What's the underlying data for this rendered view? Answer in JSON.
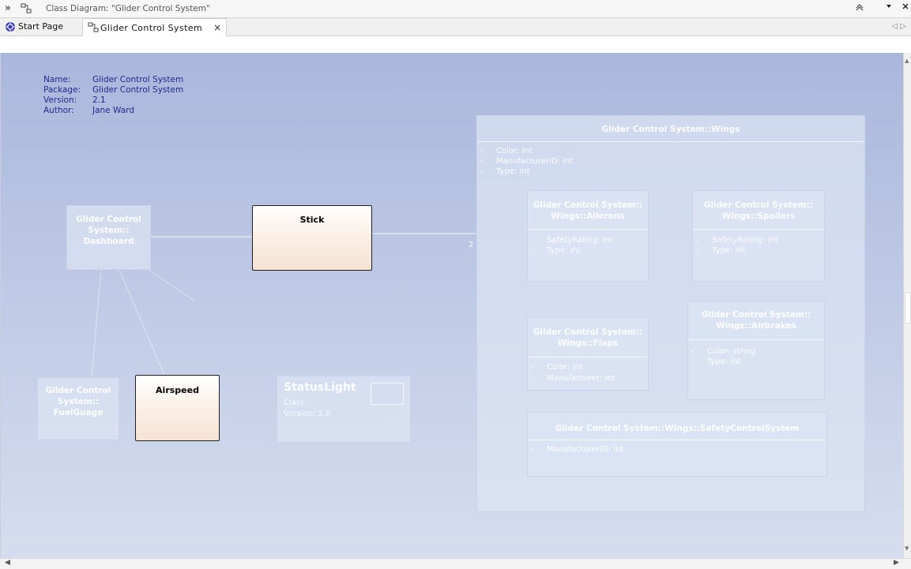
{
  "window": {
    "title": "Class Diagram: \"Glider Control System\"",
    "expand_glyph": "»",
    "controls": [
      "collapse-glyph",
      "dropdown-glyph",
      "close-glyph"
    ]
  },
  "tabs": [
    {
      "label": "Start Page",
      "icon": "start-page-icon",
      "active": false
    },
    {
      "label": "Glider Control System",
      "icon": "class-diagram-icon",
      "active": true,
      "close": "×"
    }
  ],
  "tab_nav": "◁ ▷",
  "diagram_notes": {
    "name_key": "Name:",
    "name_val": "Glider Control System",
    "package_key": "Package:",
    "package_val": "Glider Control System",
    "version_key": "Version:",
    "version_val": "2.1",
    "author_key": "Author:",
    "author_val": "Jane Ward"
  },
  "elements": {
    "dashboard": {
      "line1": "Glider Control",
      "line2": "System::",
      "line3": "Dashboard"
    },
    "fuelguage": {
      "line1": "Glider Control",
      "line2": "System::",
      "line3": "FuelGuage"
    },
    "stick": {
      "label": "Stick"
    },
    "airspeed": {
      "label": "Airspeed"
    },
    "statuslight": {
      "name": "StatusLight",
      "line1": "Class",
      "line2": "Version: 2.0"
    },
    "wings": {
      "header": "Glider Control System::Wings",
      "attrs": [
        "Color: int",
        "ManufacturerID: int",
        "Type: int"
      ],
      "multiplicity": "2"
    },
    "ailerons": {
      "line1": "Glider Control System::",
      "line2": "Wings::Ailerons",
      "attrs": [
        "SafetyRating: int",
        "Type: int"
      ]
    },
    "spoilers": {
      "line1": "Glider Control System::",
      "line2": "Wings::Spoilers",
      "attrs": [
        "SafetyRating: int",
        "Type: int"
      ]
    },
    "airbrakes": {
      "line1": "Glider Control System::",
      "line2": "Wings::Airbrakes",
      "attrs": [
        "Color: string",
        "Type: int"
      ]
    },
    "flaps": {
      "line1": "Glider Control System::",
      "line2": "Wings::Flaps",
      "attrs": [
        "Color: int",
        "Manufacturer: int"
      ]
    },
    "safety": {
      "header": "Glider Control System::Wings::SafetyControlSystem",
      "attrs": [
        "ManufacturerID: int"
      ]
    }
  },
  "attr_dash": "-",
  "colors": {
    "canvas_top": "#aab7dc",
    "canvas_bottom": "#d6ddef",
    "note_text": "#1f2a8c",
    "element_fill": "#f6e2d4"
  }
}
